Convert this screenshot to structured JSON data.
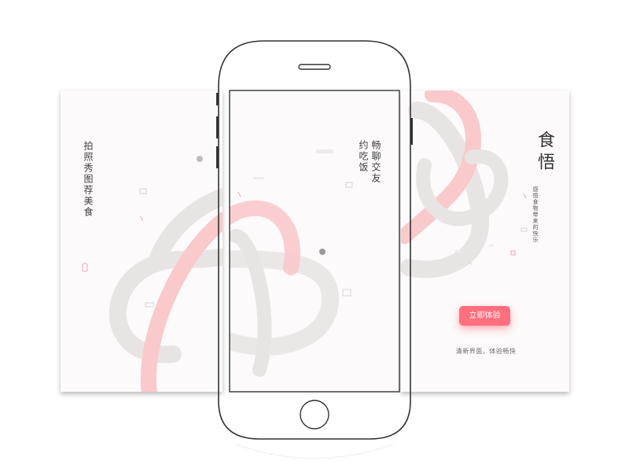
{
  "left_screen": {
    "caption": "拍照秀图荐美食"
  },
  "center_screen": {
    "caption_line1": "畅聊交友",
    "caption_line2": "约吃饭"
  },
  "right_screen": {
    "brand_title": "食悟",
    "brand_tagline": "感悟食物带来的快乐",
    "start_button_label": "立即体验",
    "footer_note": "清新界面，体验畅快"
  },
  "colors": {
    "accent": "#ff6f7d",
    "swirl_gray": "#e8e4e3",
    "swirl_pink": "#f9c9cb",
    "panel_bg": "#fcfafa",
    "phone_outline": "#333333"
  },
  "icons": [
    "phone-frame-icon",
    "home-button-icon",
    "earpiece-icon",
    "food-doodle-icon"
  ]
}
